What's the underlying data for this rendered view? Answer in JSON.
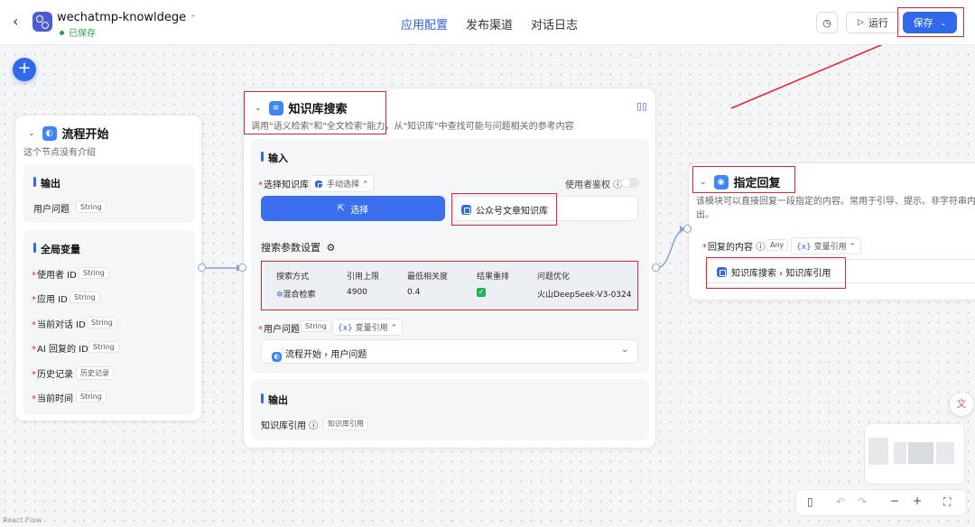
{
  "header": {
    "app_name": "wechatmp-knowldege",
    "saved_status": "已保存",
    "tabs": [
      "应用配置",
      "发布渠道",
      "对话日志"
    ],
    "run_label": "运行",
    "save_label": "保存"
  },
  "start_node": {
    "title": "流程开始",
    "description": "这个节点没有介绍",
    "output_title": "输出",
    "output_field": "用户问题",
    "output_type": "String",
    "globals_title": "全局变量",
    "globals": [
      {
        "name": "使用者 ID",
        "type": "String"
      },
      {
        "name": "应用 ID",
        "type": "String"
      },
      {
        "name": "当前对话 ID",
        "type": "String"
      },
      {
        "name": "AI 回复的 ID",
        "type": "String"
      },
      {
        "name": "历史记录",
        "type": "历史记录"
      },
      {
        "name": "当前时间",
        "type": "String"
      }
    ]
  },
  "kb_node": {
    "title": "知识库搜索",
    "description": "调用\"语义检索\"和\"全文检索\"能力，从\"知识库\"中查找可能与问题相关的参考内容",
    "input_title": "输入",
    "select_kb_label": "选择知识库",
    "mode_label": "手动选择",
    "auth_label": "使用者鉴权",
    "select_button": "选择",
    "selected_kb": "公众号文章知识库",
    "search_settings_label": "搜索参数设置",
    "table_headers": [
      "搜索方式",
      "引用上限",
      "最低相关度",
      "结果重排",
      "问题优化"
    ],
    "table_values": {
      "method": "混合检索",
      "limit": "4900",
      "min_relevance": "0.4",
      "model": "火山DeepSeek-V3-0324"
    },
    "user_question_label": "用户问题",
    "user_question_type": "String",
    "var_ref_label": "变量引用",
    "user_question_value_node": "流程开始",
    "user_question_value_field": "用户问题",
    "output_title": "输出",
    "output_field": "知识库引用",
    "output_type": "知识库引用"
  },
  "reply_node": {
    "title": "指定回复",
    "description_line1": "该模块可以直接回复一段指定的内容。常用于引导、提示。非字符串内容",
    "description_line2": "出。",
    "content_label": "回复的内容",
    "content_type": "Any",
    "var_ref_label": "变量引用",
    "ref_node": "知识库搜索",
    "ref_field": "知识库引用"
  },
  "footer": {
    "watermark": "React Flow"
  },
  "colors": {
    "accent": "#3168ec",
    "annotation": "#e8232b",
    "success": "#22a34b"
  }
}
